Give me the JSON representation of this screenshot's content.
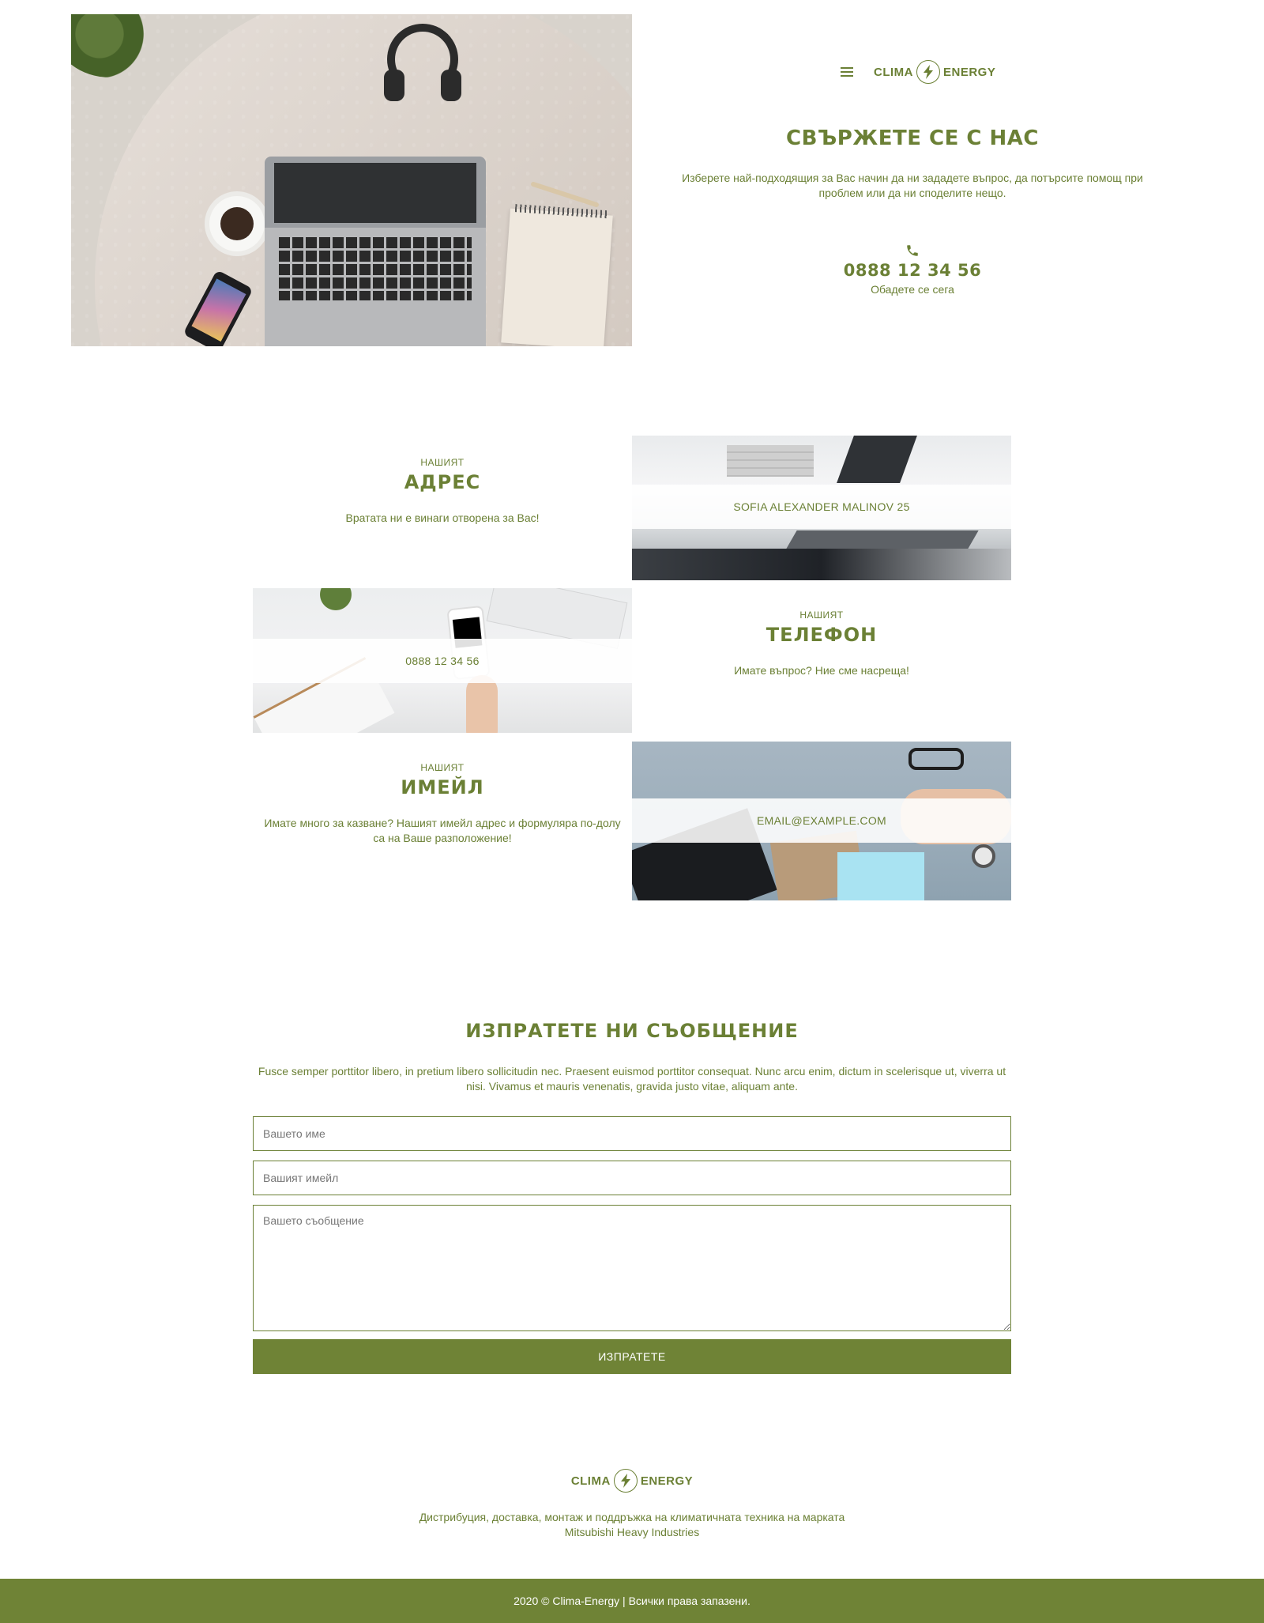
{
  "header": {
    "brand_left": "CLIMA",
    "brand_right": "ENERGY",
    "menu_icon": "hamburger-icon",
    "logo_icon": "lightning-bolt-icon"
  },
  "hero": {
    "title": "СВЪРЖЕТЕ СЕ С НАС",
    "description": "Изберете най-подходящия за Вас начин да ни зададете въпрос, да потърсите помощ при проблем или да ни споделите нещо.",
    "phone_icon": "phone-icon",
    "phone": "0888 12 34 56",
    "phone_cta": "Обадете се сега"
  },
  "contacts": {
    "address": {
      "eyebrow": "НАШИЯТ",
      "heading": "АДРЕС",
      "text": "Вратата ни е винаги отворена за Вас!",
      "value": "SOFIA ALEXANDER MALINOV 25"
    },
    "phone": {
      "eyebrow": "НАШИЯТ",
      "heading": "ТЕЛЕФОН",
      "text": "Имате въпрос? Ние сме насреща!",
      "value": "0888 12 34 56"
    },
    "email": {
      "eyebrow": "НАШИЯТ",
      "heading": "ИМЕЙЛ",
      "text": "Имате много за казване? Нашият имейл адрес и формуляра по-долу са на Ваше разположение!",
      "value": "EMAIL@EXAMPLE.COM"
    }
  },
  "form": {
    "title": "ИЗПРАТЕТЕ НИ СЪОБЩЕНИЕ",
    "description": "Fusce semper porttitor libero, in pretium libero sollicitudin nec. Praesent euismod porttitor consequat. Nunc arcu enim, dictum in scelerisque ut, viverra ut nisi. Vivamus et mauris venenatis, gravida justo vitae, aliquam ante.",
    "name_placeholder": "Вашето име",
    "name_value": "",
    "email_placeholder": "Вашият имейл",
    "email_value": "",
    "message_placeholder": "Вашето съобщение",
    "message_value": "",
    "submit_label": "ИЗПРАТЕТЕ"
  },
  "footer": {
    "brand_left": "CLIMA",
    "brand_right": "ENERGY",
    "description_line1": "Дистрибуция, доставка, монтаж и поддръжка на климатичната техника на марката",
    "description_line2": "Mitsubishi Heavy Industries",
    "copyright": "2020 © Clima-Energy | Всички права запазени."
  },
  "colors": {
    "accent": "#6b8035",
    "button": "#6f8336",
    "background": "#ffffff"
  }
}
